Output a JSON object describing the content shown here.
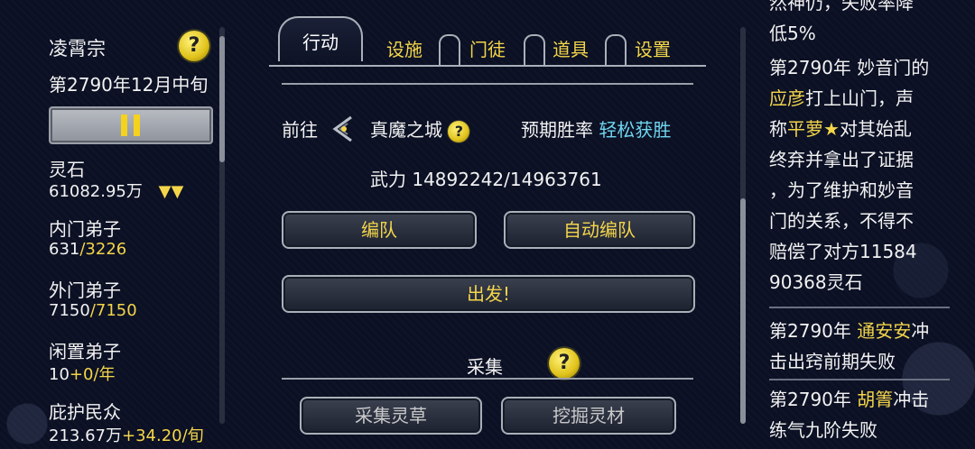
{
  "sect": {
    "name": "凌霄宗",
    "date": "第2790年12月中旬"
  },
  "stats": {
    "spirit_stone_label": "灵石",
    "spirit_stone_value": "61082.95万",
    "spirit_stone_trend": "▼▼",
    "inner_label": "内门弟子",
    "inner_current": "631",
    "inner_max": "/3226",
    "outer_label": "外门弟子",
    "outer_current": "7150",
    "outer_max": "/7150",
    "idle_label": "闲置弟子",
    "idle_current": "10",
    "idle_rate": "+0/年",
    "people_label": "庇护民众",
    "people_current": "213.67万",
    "people_rate": "+34.20/旬"
  },
  "tabs": {
    "active": "行动",
    "items": [
      "设施",
      "门徒",
      "道具",
      "设置"
    ]
  },
  "expedition": {
    "goto_label": "前往",
    "target": "真魔之城",
    "win_rate_label": "预期胜率",
    "win_rate_value": "轻松获胜",
    "power_label": "武力",
    "power_value": "14892242/14963761",
    "team_button": "编队",
    "auto_team_button": "自动编队",
    "depart_button": "出发!"
  },
  "gather": {
    "title": "采集",
    "herb_button": "采集灵草",
    "mine_button": "挖掘灵材"
  },
  "log": {
    "entry0_tail": "低5%",
    "entry0_partial": "然神仍，失败率降",
    "entry1_pre": "第2790年 妙音门的",
    "entry1_name1": "应彦",
    "entry1_mid1": "打上山门，声",
    "entry1_line3_pre": "称",
    "entry1_name2": "平萝★",
    "entry1_line3_post": "对其始乱",
    "entry1_line4": "终弃并拿出了证据",
    "entry1_line5": "，为了维护和妙音",
    "entry1_line6": "门的关系，不得不",
    "entry1_line7": "赔偿了对方11584",
    "entry1_line8": "90368灵石",
    "entry2_pre": "第2790年 ",
    "entry2_name": "通安安",
    "entry2_post": "冲",
    "entry2_line2": "击出窍前期失败",
    "entry3_pre": "第2790年 ",
    "entry3_name": "胡箐",
    "entry3_post": "冲击",
    "entry3_line2": "练气九阶失败"
  }
}
